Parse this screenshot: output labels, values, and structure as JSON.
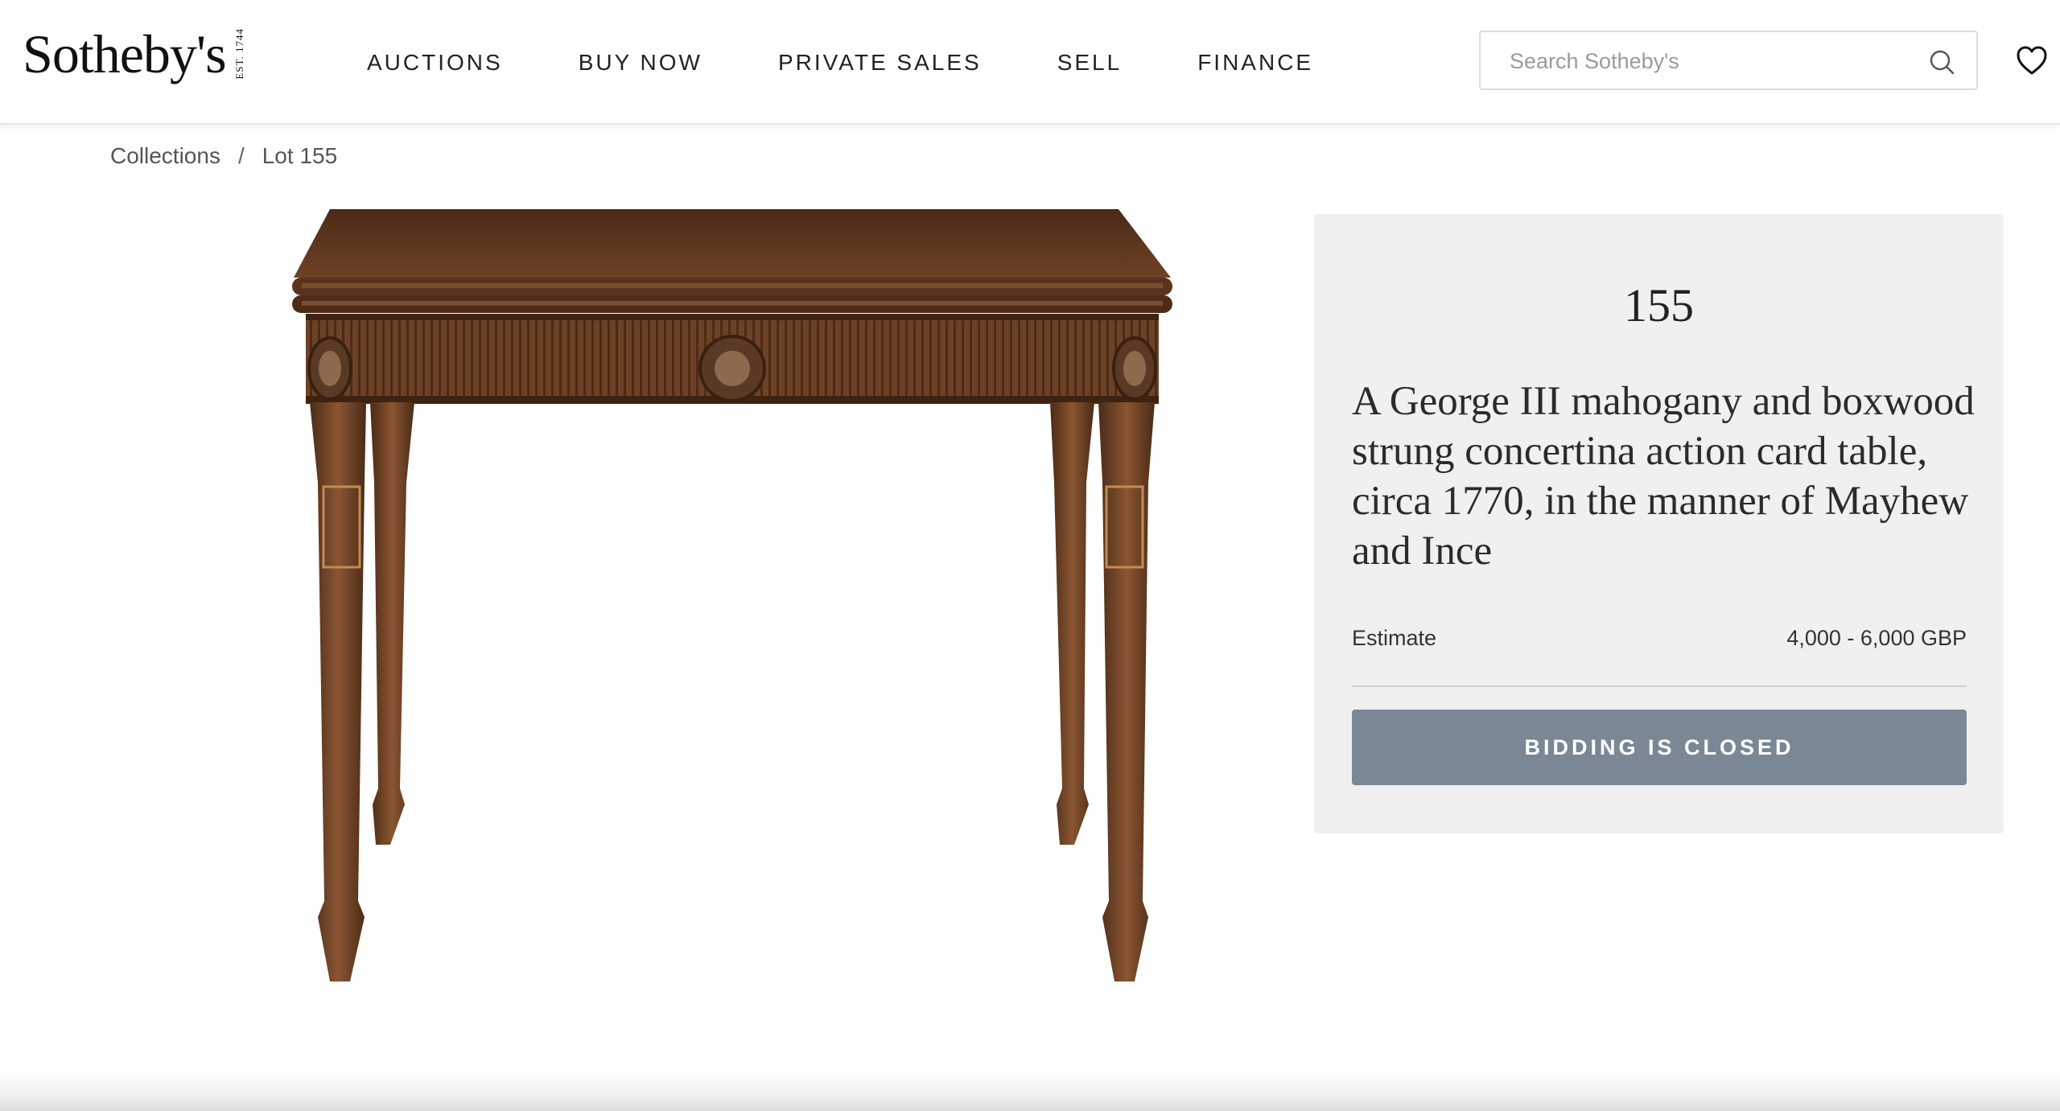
{
  "header": {
    "logo": {
      "wordmark": "Sotheby's",
      "est": "EST. 1744"
    },
    "nav": [
      "AUCTIONS",
      "BUY NOW",
      "PRIVATE SALES",
      "SELL",
      "FINANCE"
    ],
    "search": {
      "placeholder": "Search Sotheby's",
      "icon": "search-icon"
    },
    "favorite_icon": "heart-icon"
  },
  "breadcrumb": {
    "items": [
      "Collections",
      "Lot 155"
    ],
    "separator": "/"
  },
  "lot": {
    "number": "155",
    "title": "A George III mahogany and boxwood strung concertina action card table, circa 1770, in the manner of Mayhew and Ince",
    "estimate_label": "Estimate",
    "estimate_value": "4,000 - 6,000 GBP",
    "status_button": "BIDDING IS CLOSED"
  },
  "colors": {
    "button": "#7a8795",
    "panel": "#f0f0f0",
    "wood": "#6b3f22"
  }
}
